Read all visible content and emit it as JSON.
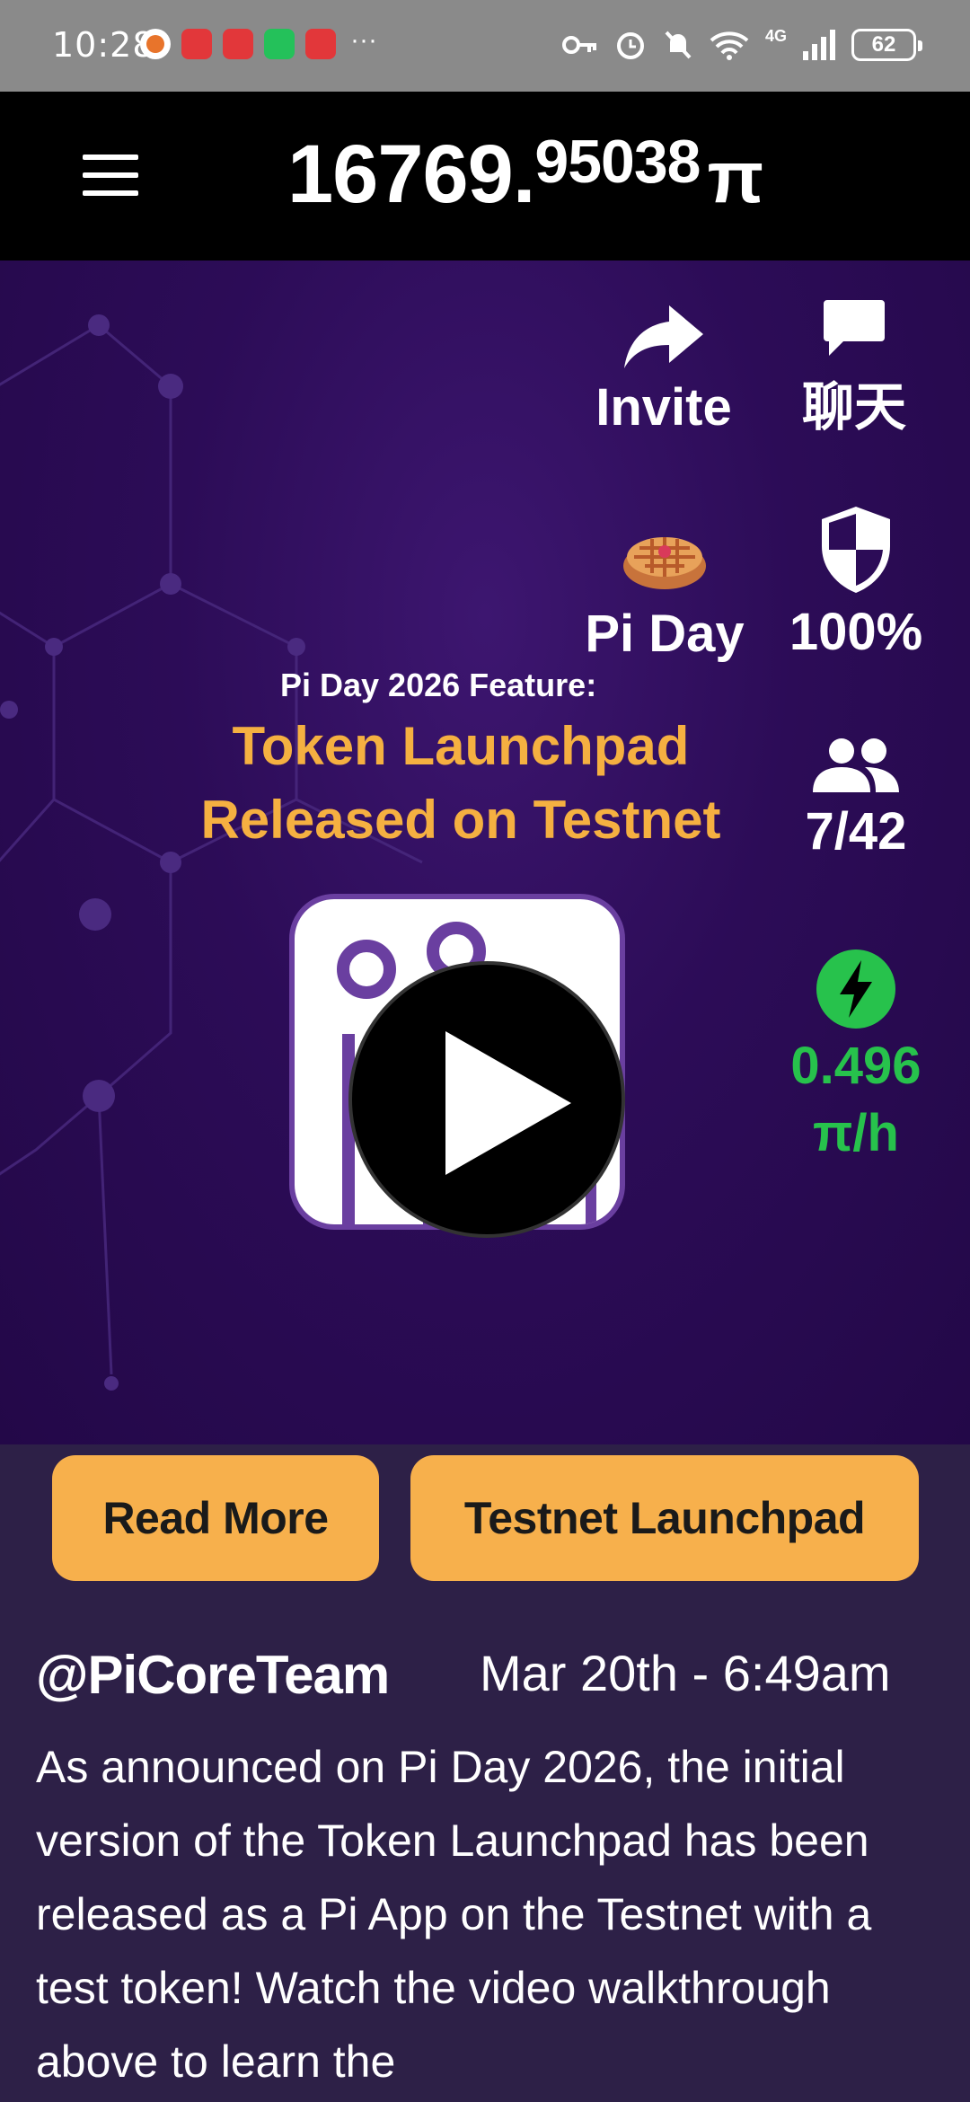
{
  "status_bar": {
    "time": "10:28",
    "notification_icons": [
      "app-icon",
      "huawei-icon",
      "huawei-icon",
      "wechat-icon",
      "huawei-icon"
    ],
    "more_indicator": "···",
    "network": "4G",
    "battery": "62"
  },
  "header": {
    "balance_integer": "16769.",
    "balance_decimal": "95038",
    "currency_symbol": "π"
  },
  "hero": {
    "feature_kicker": "Pi Day 2026 Feature:",
    "feature_title_line1": "Token Launchpad",
    "feature_title_line2": "Released on Testnet"
  },
  "side_actions": {
    "invite_label": "Invite",
    "chat_label": "聊天",
    "piday_label": "Pi Day",
    "security_label": "100%",
    "team_label": "7/42",
    "mining_rate": "0.496",
    "mining_unit": "π/h"
  },
  "buttons": {
    "read_more": "Read More",
    "testnet_launchpad": "Testnet Launchpad"
  },
  "post": {
    "author": "@PiCoreTeam",
    "date": "Mar 20th - 6:49am",
    "body": "As announced on Pi Day 2026, the initial version of the Token Launchpad has been released as a Pi App on the Testnet with a test token! Watch the video walkthrough above to learn the"
  },
  "colors": {
    "accent_orange": "#f7b04c",
    "mining_green": "#27c24c",
    "hero_purple": "#2c0c57",
    "title_gold": "#f5b041"
  }
}
